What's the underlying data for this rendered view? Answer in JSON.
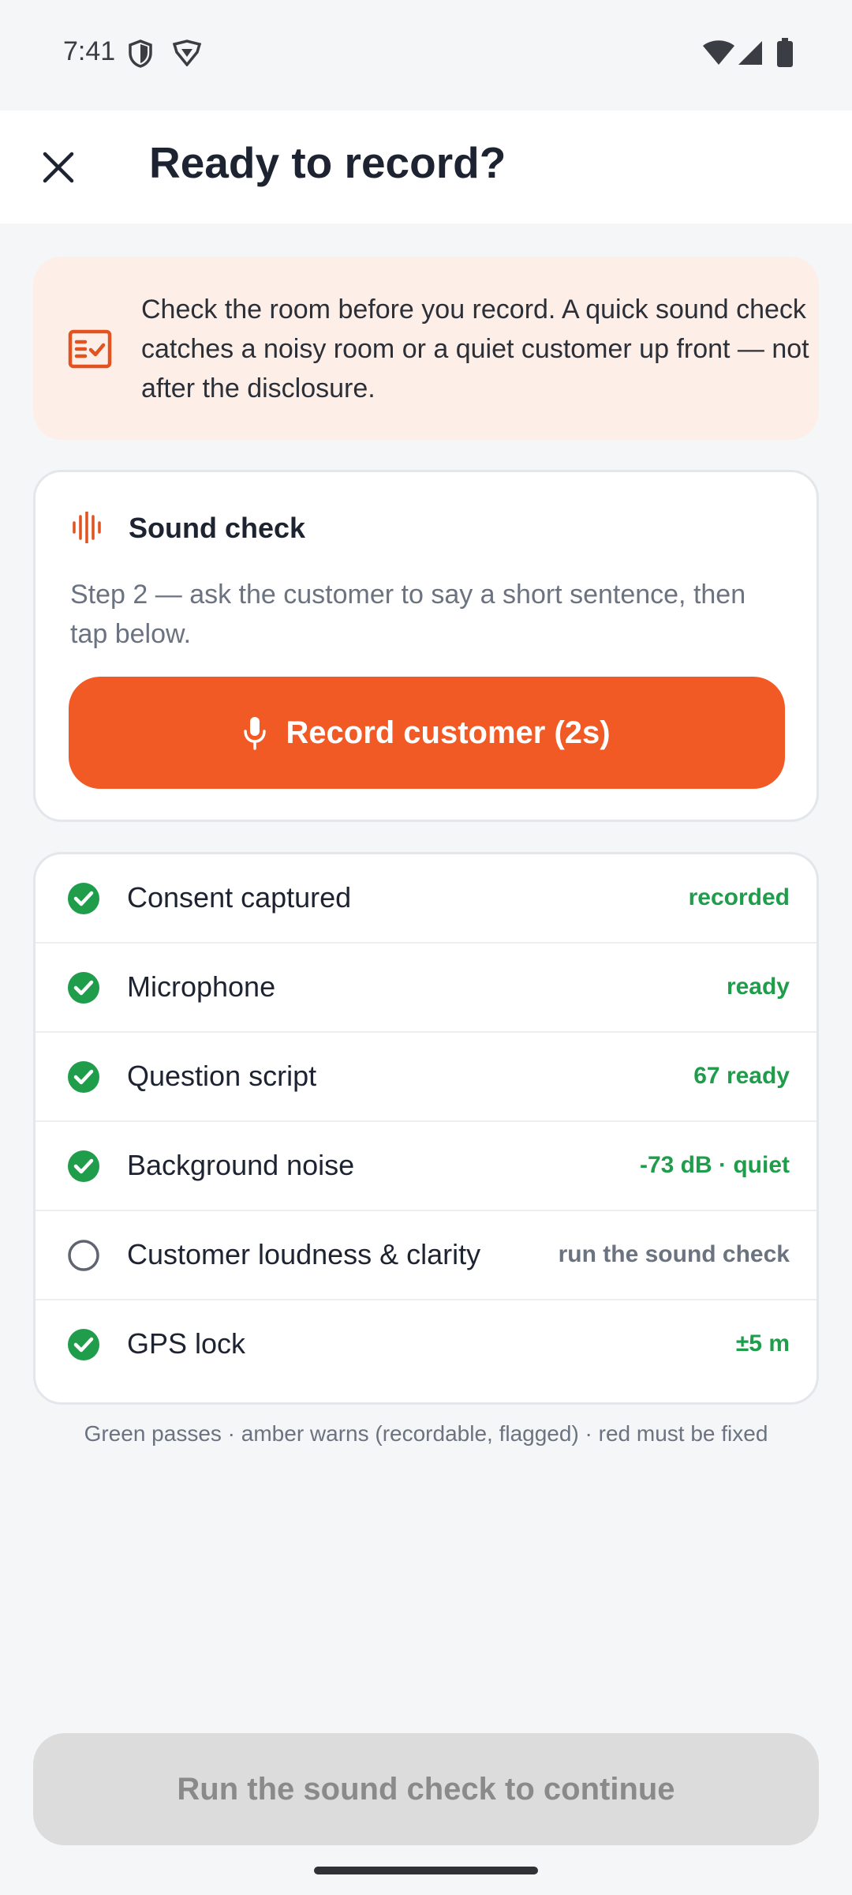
{
  "status_bar": {
    "time": "7:41",
    "icons": [
      "shield-icon",
      "vpn-icon",
      "wifi-icon",
      "signal-icon",
      "battery-icon"
    ]
  },
  "header": {
    "close_icon": "close-icon",
    "title": "Ready to record?"
  },
  "notice": {
    "icon": "checklist-icon",
    "text": "Check the room before you record. A quick sound check catches a noisy room or a quiet customer up front — not after the disclosure."
  },
  "sound_check": {
    "icon": "waveform-icon",
    "title": "Sound check",
    "description": "Step 2 — ask the customer to say a short sentence, then tap below.",
    "button_label": "Record customer (2s)",
    "button_icon": "microphone-icon"
  },
  "checks": [
    {
      "label": "Consent captured",
      "status": "recorded",
      "state": "pass"
    },
    {
      "label": "Microphone",
      "status": "ready",
      "state": "pass"
    },
    {
      "label": "Question script",
      "status": "67 ready",
      "state": "pass"
    },
    {
      "label": "Background noise",
      "status": "-73 dB · quiet",
      "state": "pass"
    },
    {
      "label": "Customer loudness & clarity",
      "status": "run the sound check",
      "state": "pending"
    },
    {
      "label": "GPS lock",
      "status": "±5 m",
      "state": "pass"
    }
  ],
  "legend": "Green passes · amber warns (recordable, flagged) · red must be fixed",
  "footer": {
    "continue_label": "Run the sound check to continue"
  },
  "colors": {
    "accent": "#f15a24",
    "pass": "#1f9d4a",
    "pending": "#6b7280",
    "notice_bg": "#fdefe8",
    "disabled_bg": "#dcdcdc"
  }
}
